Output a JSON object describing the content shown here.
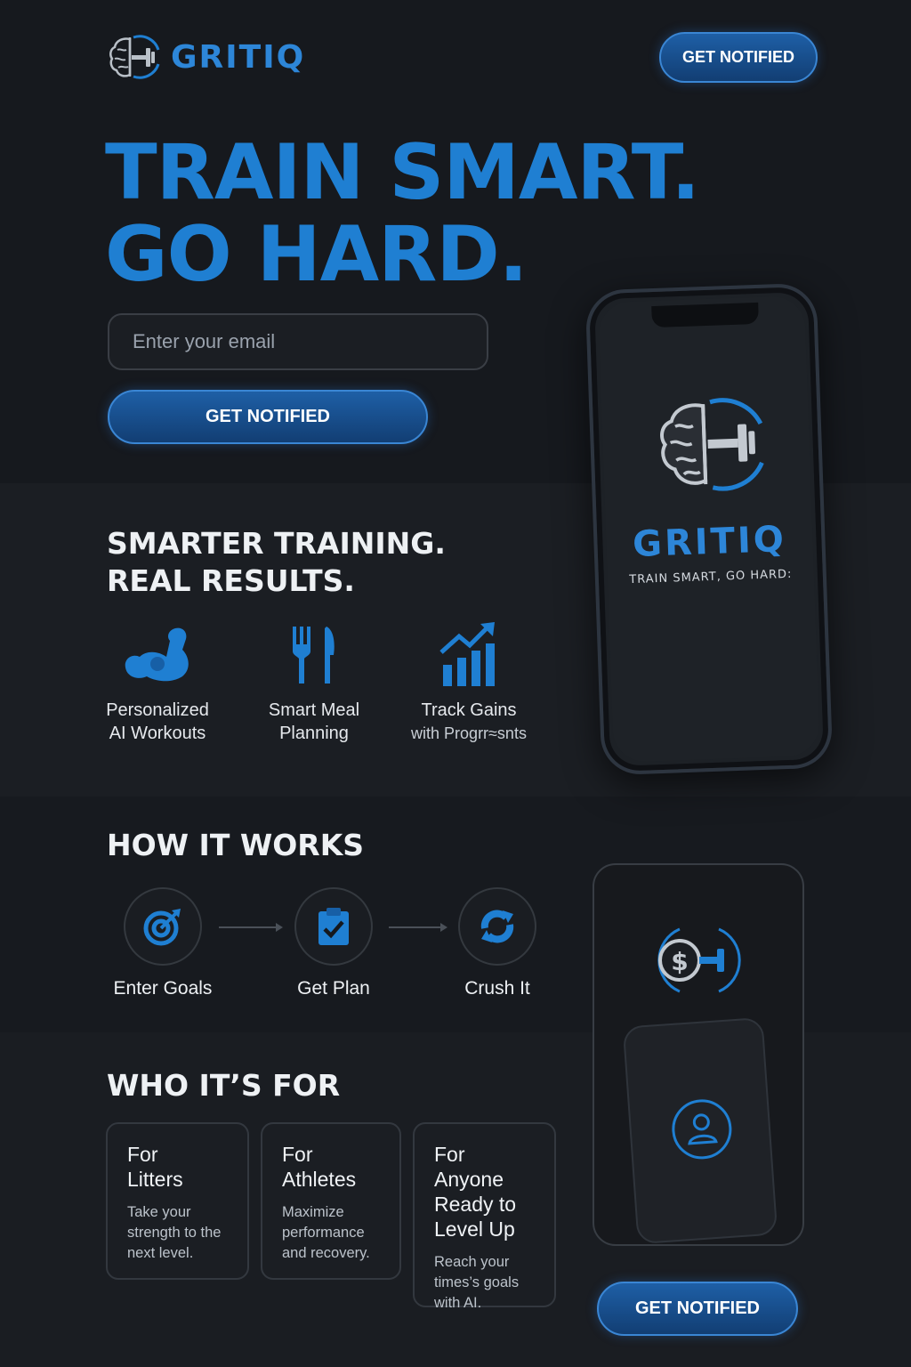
{
  "header": {
    "brand": "GRITIQ",
    "cta_label": "GET NOTIFIED"
  },
  "hero": {
    "title_line1": "TRAIN SMART.",
    "title_line2": "GO HARD.",
    "email_placeholder": "Enter your email",
    "cta_label": "GET NOTIFIED"
  },
  "phone": {
    "brand": "GRITIQ",
    "tagline": "TRAIN SMART, GO HARD:"
  },
  "features": {
    "title_line1": "SMARTER TRAINING.",
    "title_line2": "REAL RESULTS.",
    "items": [
      {
        "line1": "Personalized",
        "line2": "AI Workouts",
        "icon": "flexed-bicep-icon"
      },
      {
        "line1": "Smart Meal",
        "line2": "Planning",
        "icon": "fork-knife-icon"
      },
      {
        "line1": "Track Gains",
        "line2": "with Progrr≈snts",
        "icon": "growth-chart-icon"
      }
    ]
  },
  "how_it_works": {
    "title": "HOW IT WORKS",
    "steps": [
      {
        "label": "Enter Goals",
        "icon": "target-icon"
      },
      {
        "label": "Get Plan",
        "icon": "clipboard-check-icon"
      },
      {
        "label": "Crush It",
        "icon": "refresh-icon"
      }
    ]
  },
  "who_its_for": {
    "title": "WHO IT’S FOR",
    "cards": [
      {
        "title_line1": "For",
        "title_line2": "Litters",
        "title_line3": "",
        "body": "Take your strength to the next level."
      },
      {
        "title_line1": "For",
        "title_line2": "Athletes",
        "title_line3": "",
        "body": "Maximize performance and recovery."
      },
      {
        "title_line1": "For Anyone",
        "title_line2": "Ready to",
        "title_line3": "Level Up",
        "body": "Reach your times’s goals with AI."
      }
    ]
  },
  "footer": {
    "cta_label": "GET NOTIFIED"
  },
  "colors": {
    "accent": "#1f7fd2",
    "background": "#15181d",
    "button": "#1e5fa6"
  }
}
